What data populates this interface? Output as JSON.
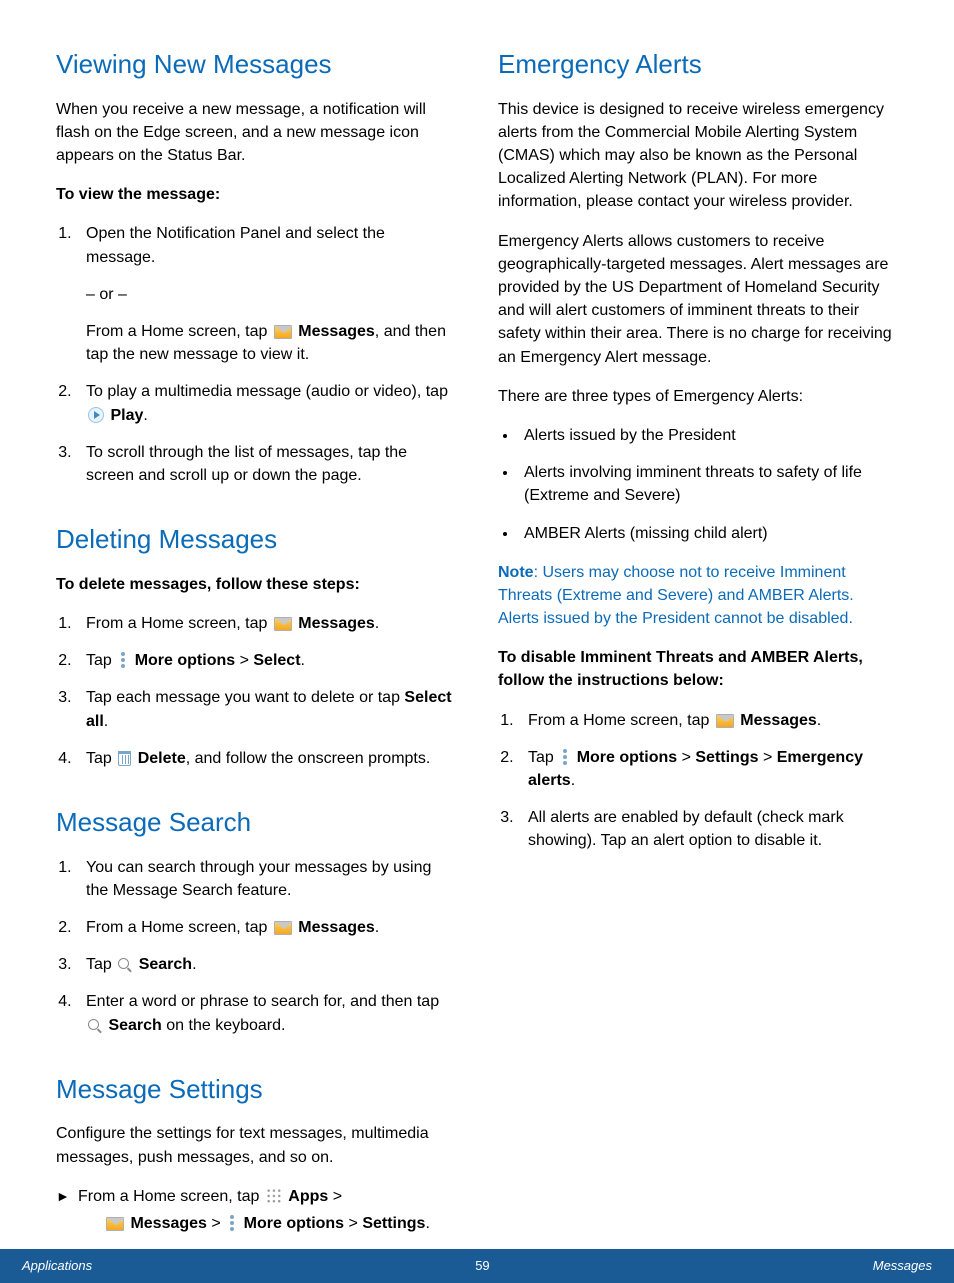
{
  "left": {
    "viewing": {
      "heading": "Viewing New Messages",
      "intro": "When you receive a new message, a notification will flash on the Edge screen, and a new message  icon appears on the Status Bar.",
      "sub": "To view the message:",
      "step1": "Open the Notification Panel and select the message.",
      "or": "– or –",
      "step1b_pre": "From a Home screen, tap ",
      "step1b_bold": "Messages",
      "step1b_post": ", and then tap the new message to view it.",
      "step2_pre": "To play a multimedia message (audio or video), tap ",
      "step2_bold": "Play",
      "step2_post": ".",
      "step3": "To scroll through the list of messages, tap the screen and scroll up or down the page."
    },
    "deleting": {
      "heading": "Deleting Messages",
      "sub": "To delete messages, follow these steps:",
      "s1_pre": "From a Home screen, tap ",
      "s1_bold": "Messages",
      "s1_post": ".",
      "s2_pre": "Tap ",
      "s2_b1": "More options",
      "s2_mid": " > ",
      "s2_b2": "Select",
      "s2_post": ".",
      "s3_pre": "Tap each message you want to delete or tap ",
      "s3_bold": "Select all",
      "s3_post": ".",
      "s4_pre": "Tap ",
      "s4_bold": "Delete",
      "s4_post": ", and follow the onscreen prompts."
    },
    "search": {
      "heading": "Message Search",
      "s1": "You can search through your messages by using the Message Search feature.",
      "s2_pre": "From a Home screen, tap ",
      "s2_bold": "Messages",
      "s2_post": ".",
      "s3_pre": "Tap ",
      "s3_bold": "Search",
      "s3_post": ".",
      "s4_pre": "Enter a word or phrase to search for, and then tap ",
      "s4_bold": "Search",
      "s4_post": " on the keyboard."
    },
    "settings": {
      "heading": "Message Settings",
      "intro": "Configure the settings for text messages, multimedia messages, push messages, and so on.",
      "line1_pre": "From a Home screen, tap ",
      "line1_b1": "Apps",
      "line1_mid": " > ",
      "line2_b1": "Messages",
      "line2_mid1": " > ",
      "line2_b2": "More options",
      "line2_mid2": " > ",
      "line2_b3": "Settings",
      "line2_post": "."
    }
  },
  "right": {
    "heading": "Emergency Alerts",
    "p1": "This device is designed to receive wireless emergency alerts from the Commercial Mobile Alerting System (CMAS) which may also be known as the Personal Localized Alerting Network (PLAN). For more information, please contact your wireless provider.",
    "p2": "Emergency Alerts allows customers to receive geographically-targeted messages. Alert messages are provided by the US Department of Homeland Security and will alert customers of imminent threats to their safety within their area. There is no charge for receiving an Emergency Alert message.",
    "p3": "There are three types of Emergency Alerts:",
    "b1": "Alerts issued by the President",
    "b2": "Alerts involving imminent threats to safety of life (Extreme and Severe)",
    "b3": "AMBER Alerts (missing child alert)",
    "note_label": "Note",
    "note_body": ": Users may choose not to receive Imminent Threats (Extreme and Severe) and AMBER Alerts. Alerts issued by the President cannot be disabled.",
    "sub": "To disable Imminent Threats and AMBER Alerts, follow the instructions below:",
    "s1_pre": "From a Home screen, tap ",
    "s1_bold": "Messages",
    "s1_post": ".",
    "s2_pre": "Tap ",
    "s2_b1": "More options",
    "s2_mid1": " > ",
    "s2_b2": "Settings",
    "s2_mid2": " > ",
    "s2_b3": "Emergency alerts",
    "s2_post": ".",
    "s3": "All alerts are enabled by default (check mark showing). Tap an alert option to disable it."
  },
  "footer": {
    "left": "Applications",
    "page": "59",
    "right": "Messages"
  }
}
